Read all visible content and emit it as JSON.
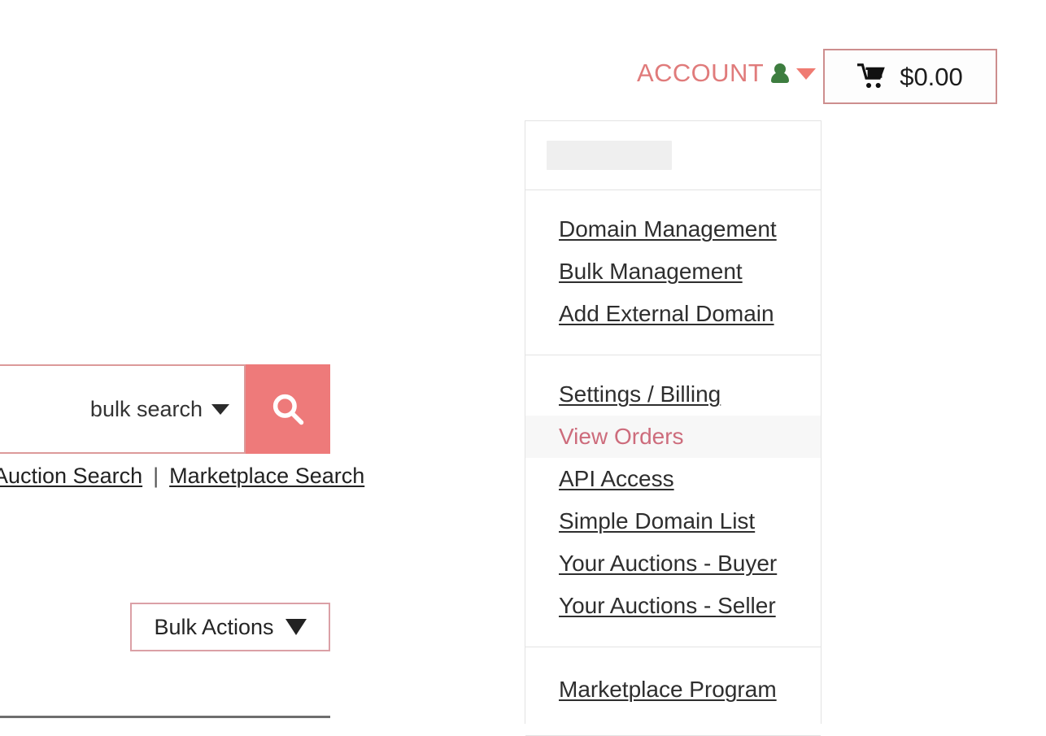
{
  "header": {
    "account": {
      "label": "ACCOUNT",
      "person_icon": "person-icon",
      "caret_icon": "caret-down-icon",
      "label_color": "#e07b7b",
      "person_color": "#3d7d3f",
      "caret_color": "#ef7b72"
    },
    "cart": {
      "icon": "shopping-cart-icon",
      "amount": "$0.00",
      "border_color": "#cd8e8e"
    }
  },
  "account_dropdown": {
    "skeleton_placeholder": "",
    "groups": [
      {
        "items": [
          {
            "label": "Domain Management",
            "active": false
          },
          {
            "label": "Bulk Management",
            "active": false
          },
          {
            "label": "Add External Domain",
            "active": false
          }
        ]
      },
      {
        "items": [
          {
            "label": "Settings / Billing",
            "active": false
          },
          {
            "label": "View Orders",
            "active": true
          },
          {
            "label": "API Access",
            "active": false
          },
          {
            "label": "Simple Domain List",
            "active": false
          },
          {
            "label": "Your Auctions - Buyer",
            "active": false
          },
          {
            "label": "Your Auctions - Seller",
            "active": false
          }
        ]
      },
      {
        "items": [
          {
            "label": "Marketplace Program",
            "active": false
          }
        ]
      }
    ],
    "active_item_color": "#cd6c7c",
    "active_item_bg": "#f7f7f7",
    "link_color": "#2e2e2e"
  },
  "search": {
    "mode_label": "bulk search",
    "mode_caret_icon": "caret-down-icon",
    "search_button_icon": "search-icon",
    "accent_color": "#ee7a7a",
    "border_color": "#dc9a9a",
    "links": [
      {
        "label": "Auction Search"
      },
      {
        "label": "Marketplace Search"
      }
    ],
    "link_separator": "|"
  },
  "toolbar": {
    "bulk_actions_label": "Bulk Actions",
    "bulk_actions_caret_icon": "caret-down-icon",
    "bulk_actions_border_color": "#dba0a6"
  }
}
